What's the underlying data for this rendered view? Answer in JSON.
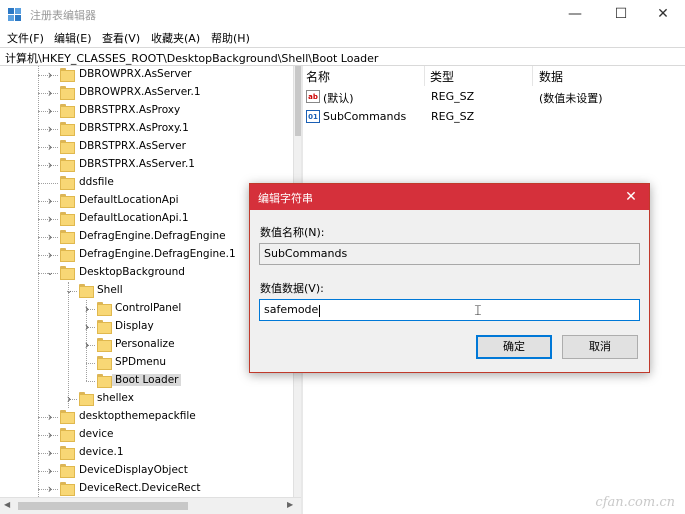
{
  "window": {
    "title": "注册表编辑器",
    "minimize": "—",
    "maximize": "☐",
    "close": "✕"
  },
  "menu": [
    "文件(F)",
    "编辑(E)",
    "查看(V)",
    "收藏夹(A)",
    "帮助(H)"
  ],
  "address": "计算机\\HKEY_CLASSES_ROOT\\DesktopBackground\\Shell\\Boot Loader",
  "tree": [
    {
      "label": "DBROWPRX.AsServer",
      "twisty": ">",
      "depth": 0
    },
    {
      "label": "DBROWPRX.AsServer.1",
      "twisty": ">",
      "depth": 0
    },
    {
      "label": "DBRSTPRX.AsProxy",
      "twisty": ">",
      "depth": 0
    },
    {
      "label": "DBRSTPRX.AsProxy.1",
      "twisty": ">",
      "depth": 0
    },
    {
      "label": "DBRSTPRX.AsServer",
      "twisty": ">",
      "depth": 0
    },
    {
      "label": "DBRSTPRX.AsServer.1",
      "twisty": ">",
      "depth": 0
    },
    {
      "label": "ddsfile",
      "twisty": "",
      "depth": 0
    },
    {
      "label": "DefaultLocationApi",
      "twisty": ">",
      "depth": 0
    },
    {
      "label": "DefaultLocationApi.1",
      "twisty": ">",
      "depth": 0
    },
    {
      "label": "DefragEngine.DefragEngine",
      "twisty": ">",
      "depth": 0
    },
    {
      "label": "DefragEngine.DefragEngine.1",
      "twisty": ">",
      "depth": 0
    },
    {
      "label": "DesktopBackground",
      "twisty": "v",
      "depth": 0
    },
    {
      "label": "Shell",
      "twisty": "v",
      "depth": 1
    },
    {
      "label": "ControlPanel",
      "twisty": ">",
      "depth": 2
    },
    {
      "label": "Display",
      "twisty": ">",
      "depth": 2
    },
    {
      "label": "Personalize",
      "twisty": ">",
      "depth": 2
    },
    {
      "label": "SPDmenu",
      "twisty": "",
      "depth": 2
    },
    {
      "label": "Boot Loader",
      "twisty": "",
      "depth": 2,
      "selected": true
    },
    {
      "label": "shellex",
      "twisty": ">",
      "depth": 1
    },
    {
      "label": "desktopthemepackfile",
      "twisty": ">",
      "depth": 0
    },
    {
      "label": "device",
      "twisty": ">",
      "depth": 0
    },
    {
      "label": "device.1",
      "twisty": ">",
      "depth": 0
    },
    {
      "label": "DeviceDisplayObject",
      "twisty": ">",
      "depth": 0
    },
    {
      "label": "DeviceRect.DeviceRect",
      "twisty": ">",
      "depth": 0
    }
  ],
  "list": {
    "headers": {
      "name": "名称",
      "type": "类型",
      "data": "数据"
    },
    "rows": [
      {
        "icon": "ab",
        "name": "(默认)",
        "type": "REG_SZ",
        "data": "(数值未设置)"
      },
      {
        "icon": "bin",
        "name": "SubCommands",
        "type": "REG_SZ",
        "data": ""
      }
    ]
  },
  "dialog": {
    "title": "编辑字符串",
    "close": "✕",
    "name_label": "数值名称(N):",
    "name_value": "SubCommands",
    "data_label": "数值数据(V):",
    "data_value": "safemode",
    "ok": "确定",
    "cancel": "取消"
  },
  "watermark": "cfan.com.cn"
}
